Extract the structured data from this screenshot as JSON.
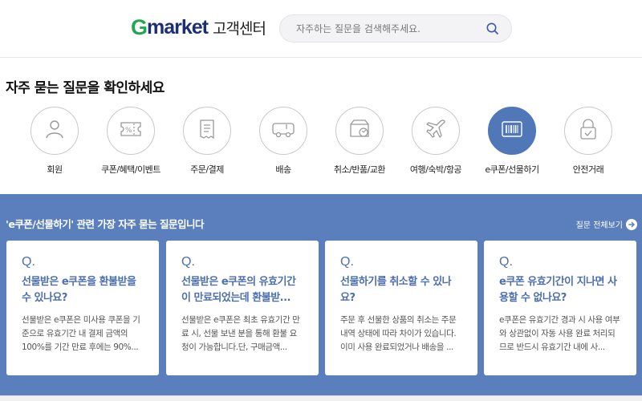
{
  "header": {
    "logo_g": "G",
    "logo_rest": "market",
    "logo_cs": "고객센터",
    "search_placeholder": "자주하는 질문을 검색해주세요."
  },
  "faq": {
    "title": "자주 묻는 질문을 확인하세요",
    "active_color": "#5077b8",
    "categories": [
      {
        "label": "회원",
        "icon": "person-icon"
      },
      {
        "label": "쿠폰/혜택/이벤트",
        "icon": "coupon-icon"
      },
      {
        "label": "주문/결제",
        "icon": "receipt-icon"
      },
      {
        "label": "배송",
        "icon": "truck-icon"
      },
      {
        "label": "취소/반품/교환",
        "icon": "box-return-icon"
      },
      {
        "label": "여행/숙박/항공",
        "icon": "airplane-icon"
      },
      {
        "label": "e쿠폰/선물하기",
        "icon": "barcode-icon"
      },
      {
        "label": "안전거래",
        "icon": "lock-icon"
      }
    ]
  },
  "popular": {
    "title": "'e쿠폰/선물하기' 관련 가장 자주 묻는 질문입니다",
    "see_all": "질문 전체보기",
    "band_color": "#5b7fbd",
    "cards": [
      {
        "q": "Q.",
        "title": "선물받은 e쿠폰을 환불받을 수 있나요?",
        "desc": "선물받은 e쿠폰은 미사용 쿠폰을 기준으로 유효기간 내 결제 금액의 100%를 기간 만료 후에는 90%..."
      },
      {
        "q": "Q.",
        "title": "선물받은 e쿠폰의 유효기간이 만료되었는데 환불받...",
        "desc": "선물받은 e쿠폰은 최초 유효기간 만료 시, 선물 보낸 분을 통해 환불 요청이 가능합니다.단, 구매금액..."
      },
      {
        "q": "Q.",
        "title": "선물하기를 취소할 수 있나요?",
        "desc": "주문 후 선물한 상품의 취소는 주문 내역 상태에 따라 차이가 있습니다. 이미 사용 완료되었거나 배송을 ..."
      },
      {
        "q": "Q.",
        "title": "e쿠폰 유효기간이 지나면 사용할 수 없나요?",
        "desc": "e쿠폰은 유효기간 경과 시 사용 여부와 상관없이 자동 사용 완료 처리되므로 반드시 유효기간 내에 사..."
      }
    ]
  }
}
